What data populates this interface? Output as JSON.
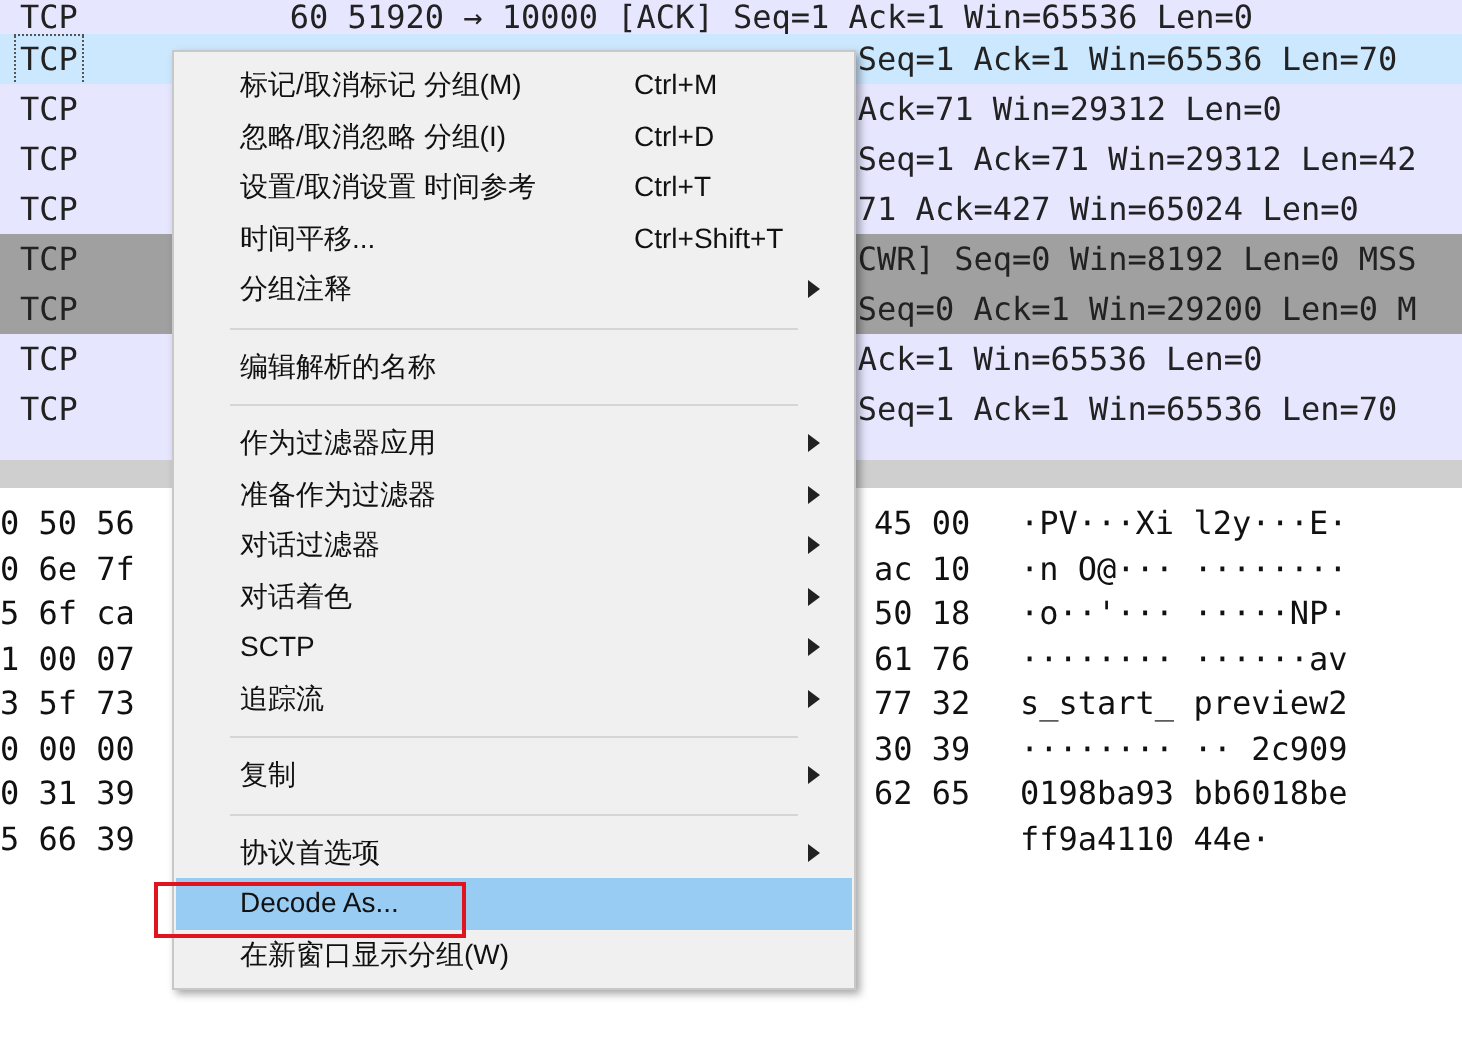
{
  "packet_list": {
    "rows": [
      {
        "protocol": "TCP",
        "info": "60 51920 → 10000 [ACK] Seq=1 Ack=1 Win=65536 Len=0",
        "selected": false,
        "shaded": false
      },
      {
        "protocol": "TCP",
        "info": "Seq=1 Ack=1 Win=65536 Len=70",
        "selected": true
      },
      {
        "protocol": "TCP",
        "info": "Ack=71 Win=29312 Len=0",
        "selected": false,
        "shaded": false
      },
      {
        "protocol": "TCP",
        "info": "Seq=1 Ack=71 Win=29312 Len=42",
        "selected": false,
        "shaded": false
      },
      {
        "protocol": "TCP",
        "info": "71 Ack=427 Win=65024 Len=0",
        "selected": false,
        "shaded": false
      },
      {
        "protocol": "TCP",
        "info": "CWR] Seq=0 Win=8192 Len=0 MSS",
        "selected": false,
        "shaded": true
      },
      {
        "protocol": "TCP",
        "info": "Seq=0 Ack=1 Win=29200 Len=0 M",
        "selected": false,
        "shaded": true
      },
      {
        "protocol": "TCP",
        "info": "Ack=1 Win=65536 Len=0",
        "selected": false,
        "shaded": false
      },
      {
        "protocol": "TCP",
        "info": "Seq=1 Ack=1 Win=65536 Len=70",
        "selected": false,
        "shaded": false
      }
    ]
  },
  "hex_dump": {
    "rows": [
      {
        "bytes_left": "0 50 56",
        "bytes_right": "45 00",
        "ascii": "·PV···Xi l2y···E·"
      },
      {
        "bytes_left": "0 6e 7f",
        "bytes_right": "ac 10",
        "ascii": "·n O@··· ········"
      },
      {
        "bytes_left": "5 6f ca",
        "bytes_right": "50 18",
        "ascii": "·o··'··· ·····NP·"
      },
      {
        "bytes_left": "1 00 07",
        "bytes_right": "61 76",
        "ascii": "········ ······av"
      },
      {
        "bytes_left": "3 5f 73",
        "bytes_right": "77 32",
        "ascii": "s_start_ preview2"
      },
      {
        "bytes_left": "0 00 00",
        "bytes_right": "30 39",
        "ascii": "········ ·· 2c909"
      },
      {
        "bytes_left": "0 31 39",
        "bytes_right": "62 65",
        "ascii": "0198ba93 bb6018be"
      },
      {
        "bytes_left": "5 66 39",
        "ascii": "ff9a4110 44e·"
      }
    ]
  },
  "context_menu": {
    "items": [
      {
        "kind": "item",
        "label": "标记/取消标记 分组(M)",
        "shortcut": "Ctrl+M",
        "submenu": false,
        "selected": false
      },
      {
        "kind": "item",
        "label": "忽略/取消忽略 分组(I)",
        "shortcut": "Ctrl+D",
        "submenu": false,
        "selected": false
      },
      {
        "kind": "item",
        "label": "设置/取消设置 时间参考",
        "shortcut": "Ctrl+T",
        "submenu": false,
        "selected": false
      },
      {
        "kind": "item",
        "label": "时间平移...",
        "shortcut": "Ctrl+Shift+T",
        "submenu": false,
        "selected": false
      },
      {
        "kind": "item",
        "label": "分组注释",
        "submenu": true,
        "selected": false
      },
      {
        "kind": "separator"
      },
      {
        "kind": "item",
        "label": "编辑解析的名称",
        "submenu": false,
        "selected": false
      },
      {
        "kind": "separator"
      },
      {
        "kind": "item",
        "label": "作为过滤器应用",
        "submenu": true,
        "selected": false
      },
      {
        "kind": "item",
        "label": "准备作为过滤器",
        "submenu": true,
        "selected": false
      },
      {
        "kind": "item",
        "label": "对话过滤器",
        "submenu": true,
        "selected": false
      },
      {
        "kind": "item",
        "label": "对话着色",
        "submenu": true,
        "selected": false
      },
      {
        "kind": "item",
        "label": "SCTP",
        "submenu": true,
        "selected": false
      },
      {
        "kind": "item",
        "label": "追踪流",
        "submenu": true,
        "selected": false
      },
      {
        "kind": "separator"
      },
      {
        "kind": "item",
        "label": "复制",
        "submenu": true,
        "selected": false
      },
      {
        "kind": "separator"
      },
      {
        "kind": "item",
        "label": "协议首选项",
        "submenu": true,
        "selected": false
      },
      {
        "kind": "item",
        "label": "Decode As...",
        "submenu": false,
        "selected": true,
        "outlined": true
      },
      {
        "kind": "item",
        "label": "在新窗口显示分组(W)",
        "submenu": false,
        "selected": false
      }
    ]
  }
}
